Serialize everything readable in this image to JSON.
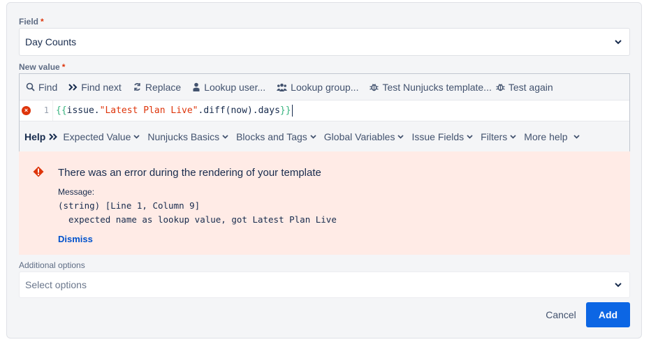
{
  "colors": {
    "accent": "#0c66e4",
    "error_bg": "#ffebe6",
    "error": "#de350b",
    "link": "#0052cc"
  },
  "field": {
    "label": "Field",
    "required_mark": "*",
    "value": "Day Counts",
    "icon": "chevron-down-icon"
  },
  "new_value": {
    "label": "New value",
    "required_mark": "*"
  },
  "toolbar": {
    "items": [
      {
        "label": "Find",
        "icon": "search-icon"
      },
      {
        "label": "Find next",
        "icon": "double-chevron-right-icon"
      },
      {
        "label": "Replace",
        "icon": "replace-icon"
      },
      {
        "label": "Lookup user...",
        "icon": "user-icon"
      },
      {
        "label": "Lookup group...",
        "icon": "group-icon"
      },
      {
        "label": "Test Nunjucks template...",
        "icon": "bug-icon"
      },
      {
        "label": "Test again",
        "icon": "bug-icon"
      }
    ]
  },
  "code": {
    "line_number": "1",
    "open": "{{",
    "before": "issue.",
    "string": "\"Latest Plan Live\"",
    "after": ".diff(now).days",
    "close": "}}"
  },
  "help": {
    "title": "Help",
    "items": [
      "Expected Value",
      "Nunjucks Basics",
      "Blocks and Tags",
      "Global Variables",
      "Issue Fields",
      "Filters",
      "More help"
    ]
  },
  "error": {
    "title": "There was an error during the rendering of your template",
    "message_label": "Message:",
    "line1": "(string) [Line 1, Column 9]",
    "line2": "  expected name as lookup value, got Latest Plan Live",
    "dismiss": "Dismiss"
  },
  "additional": {
    "label": "Additional options",
    "placeholder": "Select options"
  },
  "buttons": {
    "cancel": "Cancel",
    "add": "Add"
  }
}
